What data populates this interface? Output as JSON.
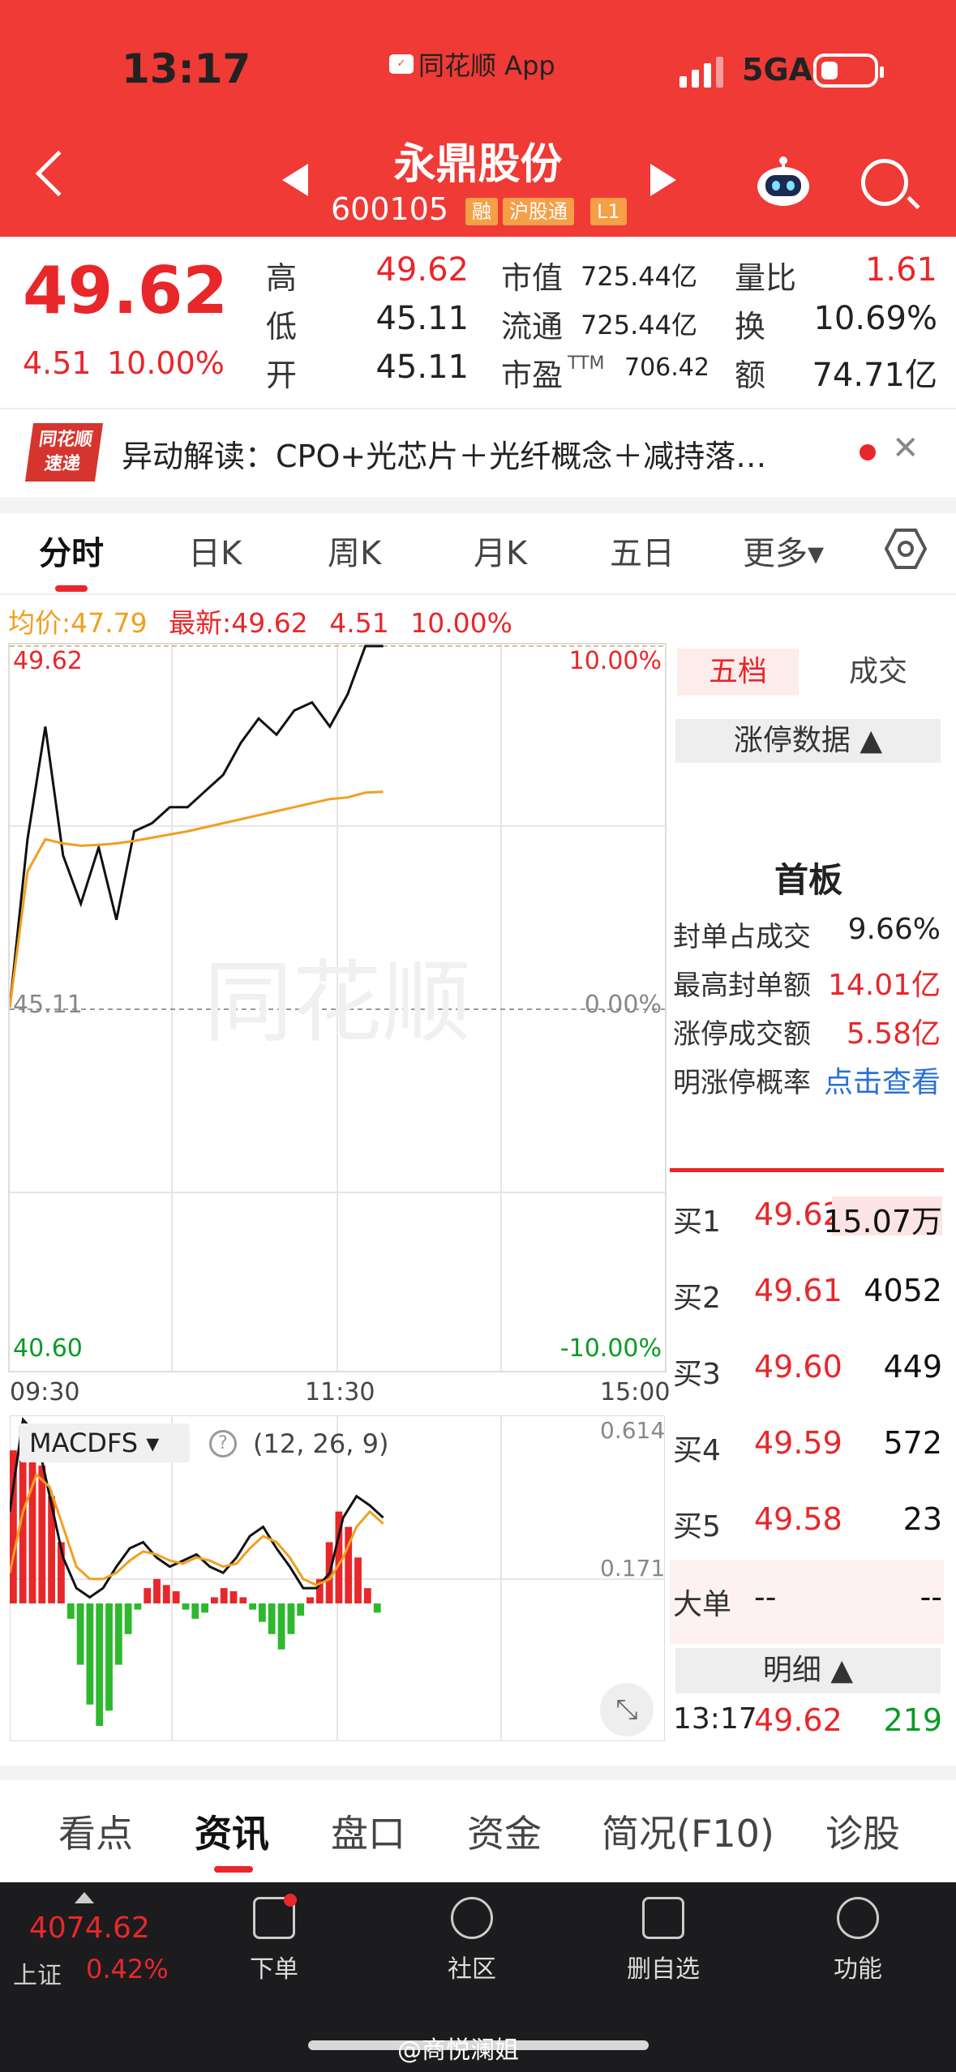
{
  "status": {
    "time": "13:17",
    "app": "同花顺 App",
    "network": "5GA"
  },
  "header": {
    "name": "永鼎股份",
    "code": "600105",
    "tags": [
      "融",
      "沪股通",
      "L1"
    ]
  },
  "quote": {
    "price": "49.62",
    "change": "4.51",
    "change_pct": "10.00%",
    "high_label": "高",
    "high": "49.62",
    "low_label": "低",
    "low": "45.11",
    "open_label": "开",
    "open": "45.11",
    "mcap_label": "市值",
    "mcap": "725.44亿",
    "float_label": "流通",
    "float": "725.44亿",
    "pe_label": "市盈",
    "pe_sup": "TTM",
    "pe": "706.42",
    "vr_label": "量比",
    "vr": "1.61",
    "turn_label": "换",
    "turn": "10.69%",
    "amt_label": "额",
    "amt": "74.71亿"
  },
  "news": {
    "logo_top": "同花顺",
    "logo_bottom": "速递",
    "text": "异动解读：CPO+光芯片＋光纤概念＋减持落…",
    "close": "✕"
  },
  "chart_tabs": [
    "分时",
    "日K",
    "周K",
    "月K",
    "五日",
    "更多▾"
  ],
  "info": {
    "avg_label": "均价:",
    "avg": "47.79",
    "last_label": "最新:",
    "last": "49.62",
    "chg": "4.51",
    "pct": "10.00%"
  },
  "chart_labels": {
    "top_price": "49.62",
    "top_pct": "10.00%",
    "mid_price": "45.11",
    "mid_pct": "0.00%",
    "bot_price": "40.60",
    "bot_pct": "-10.00%",
    "t1": "09:30",
    "t2": "11:30",
    "t3": "15:00",
    "watermark": "同花顺"
  },
  "macd": {
    "name": "MACDFS ▾",
    "help": "?",
    "params": "(12, 26, 9)",
    "max": "0.614",
    "mid": "0.171"
  },
  "chart_data": {
    "type": "line",
    "title": "",
    "x": [
      "09:30",
      "11:30",
      "15:00"
    ],
    "ylim": [
      40.6,
      49.62
    ],
    "series": [
      {
        "name": "最新",
        "values": [
          45.11,
          47.2,
          48.6,
          47.0,
          46.4,
          47.1,
          46.2,
          47.3,
          47.4,
          47.6,
          47.6,
          47.8,
          48.0,
          48.4,
          48.7,
          48.5,
          48.8,
          48.9,
          48.6,
          49.0,
          49.62,
          49.62
        ]
      },
      {
        "name": "均价",
        "values": [
          45.11,
          46.8,
          47.2,
          47.15,
          47.12,
          47.13,
          47.15,
          47.18,
          47.22,
          47.26,
          47.3,
          47.35,
          47.4,
          47.45,
          47.5,
          47.55,
          47.6,
          47.65,
          47.7,
          47.72,
          47.78,
          47.79
        ]
      }
    ]
  },
  "macd_data": {
    "range": [
      -0.45,
      0.614
    ],
    "hist": [
      0.5,
      0.58,
      0.55,
      0.45,
      0.35,
      0.2,
      -0.05,
      -0.2,
      -0.33,
      -0.4,
      -0.35,
      -0.2,
      -0.1,
      -0.02,
      0.05,
      0.08,
      0.06,
      0.04,
      -0.02,
      -0.05,
      -0.03,
      0.02,
      0.05,
      0.04,
      0.02,
      -0.02,
      -0.06,
      -0.1,
      -0.15,
      -0.1,
      -0.04,
      0.02,
      0.08,
      0.2,
      0.3,
      0.25,
      0.15,
      0.05,
      -0.03
    ],
    "dif": [
      0.3,
      0.6,
      0.55,
      0.35,
      0.15,
      0.05,
      0.02,
      0.05,
      0.12,
      0.18,
      0.2,
      0.15,
      0.12,
      0.14,
      0.16,
      0.12,
      0.1,
      0.15,
      0.22,
      0.25,
      0.18,
      0.12,
      0.05,
      0.05,
      0.1,
      0.28,
      0.35,
      0.32,
      0.28
    ],
    "dea": [
      0.1,
      0.3,
      0.42,
      0.38,
      0.25,
      0.12,
      0.08,
      0.08,
      0.1,
      0.14,
      0.17,
      0.16,
      0.14,
      0.13,
      0.15,
      0.14,
      0.12,
      0.13,
      0.18,
      0.22,
      0.2,
      0.15,
      0.08,
      0.06,
      0.08,
      0.15,
      0.25,
      0.3,
      0.26
    ]
  },
  "right": {
    "tab1": "五档",
    "tab2": "成交",
    "zt_head": "涨停数据 ▲",
    "board": "首板",
    "rows": [
      {
        "label": "封单占成交",
        "value": "9.66%"
      },
      {
        "label": "最高封单额",
        "value": "14.01亿"
      },
      {
        "label": "涨停成交额",
        "value": "5.58亿"
      },
      {
        "label": "明涨停概率",
        "value": "点击查看"
      }
    ],
    "bids": [
      {
        "label": "买1",
        "price": "49.62",
        "vol": "15.07万"
      },
      {
        "label": "买2",
        "price": "49.61",
        "vol": "4052"
      },
      {
        "label": "买3",
        "price": "49.60",
        "vol": "449"
      },
      {
        "label": "买4",
        "price": "49.59",
        "vol": "572"
      },
      {
        "label": "买5",
        "price": "49.58",
        "vol": "23"
      }
    ],
    "big": {
      "label": "大单",
      "p": "--",
      "v": "--"
    },
    "detail_head": "明细 ▲",
    "detail": {
      "time": "13:17",
      "price": "49.62",
      "vol": "219"
    }
  },
  "bottom_tabs": [
    "看点",
    "资讯",
    "盘口",
    "资金",
    "简况(F10)",
    "诊股"
  ],
  "bottom_bar": {
    "index": "4074.62",
    "index_name": "上证",
    "index_pct": "0.42%",
    "items": [
      "下单",
      "社区",
      "删自选",
      "功能"
    ]
  },
  "watermark": "@商悦澜姐"
}
